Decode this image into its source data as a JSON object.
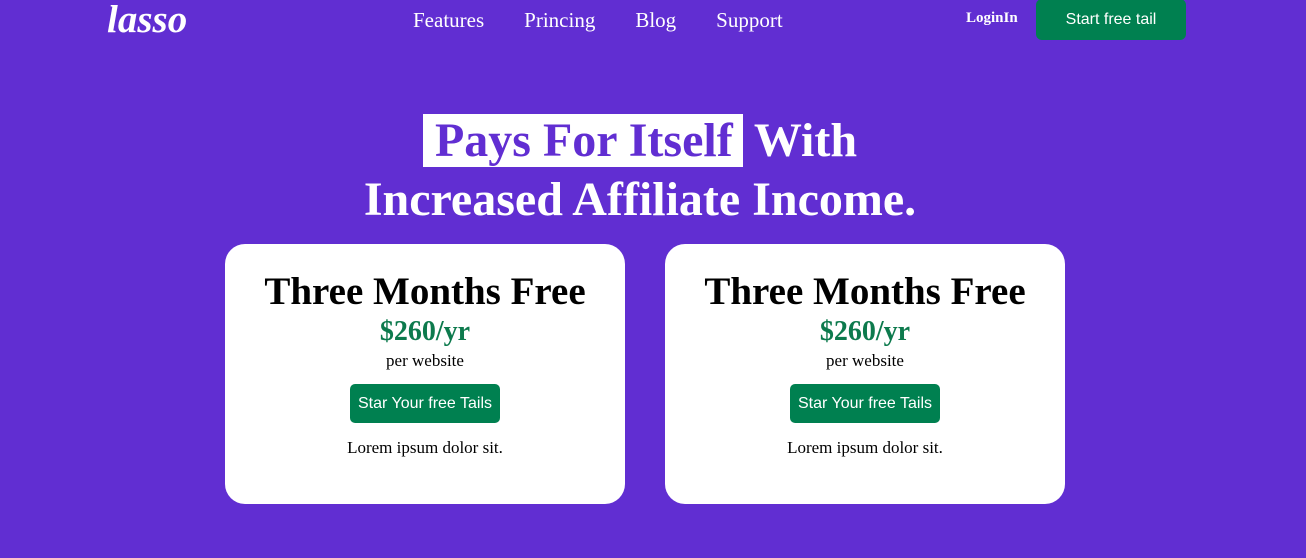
{
  "header": {
    "logo": "lasso",
    "nav": [
      "Features",
      "Princing",
      "Blog",
      "Support"
    ],
    "login_label": "LoginIn",
    "cta_label": "Start free tail"
  },
  "hero": {
    "highlight": "Pays For Itself",
    "rest_line1": "With",
    "line2": "Increased Affiliate Income."
  },
  "cards": [
    {
      "title": "Three Months Free",
      "price": "$260/yr",
      "unit": "per website",
      "button_label": "Star Your free Tails",
      "description": "Lorem ipsum dolor sit."
    },
    {
      "title": "Three Months Free",
      "price": "$260/yr",
      "unit": "per website",
      "button_label": "Star Your free Tails",
      "description": "Lorem ipsum dolor sit."
    }
  ],
  "colors": {
    "background": "#612ed2",
    "accent_green": "#008050",
    "price_green": "#0d7a4d",
    "card_bg": "#ffffff"
  }
}
